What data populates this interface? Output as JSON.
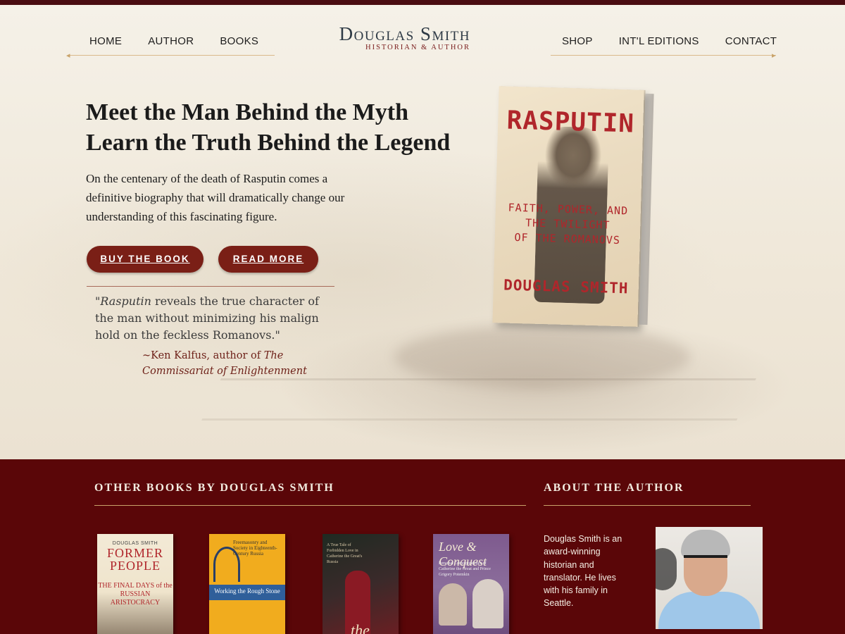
{
  "nav": {
    "left": [
      "HOME",
      "AUTHOR",
      "BOOKS"
    ],
    "right": [
      "SHOP",
      "INT'L EDITIONS",
      "CONTACT"
    ]
  },
  "logo": {
    "name": "Douglas Smith",
    "tagline": "HISTORIAN & AUTHOR"
  },
  "hero": {
    "headline_line1": "Meet the Man Behind the Myth",
    "headline_line2": "Learn the Truth Behind the Legend",
    "intro": "On the centenary of the death of Rasputin comes a definitive biography that will dramatically change our understanding of this fascinating figure.",
    "buy_label": "BUY THE BOOK",
    "read_label": "READ MORE",
    "quote_open": "\"",
    "quote_title": "Rasputin",
    "quote_rest": " reveals the true character of the man without minimizing his malign hold on the feckless Romanovs.\"",
    "attribution_prefix": "~Ken Kalfus, author of ",
    "attribution_work": "The Commissariat of Enlightenment"
  },
  "cover": {
    "title": "RASPUTIN",
    "subtitle_line1": "FAITH, POWER, AND",
    "subtitle_line2": "THE TWILIGHT",
    "subtitle_line3": "OF THE ROMANOVS",
    "author": "DOUGLAS SMITH"
  },
  "other_books": {
    "heading": "OTHER BOOKS BY DOUGLAS SMITH",
    "books": [
      {
        "author": "DOUGLAS SMITH",
        "title_line1": "FORMER",
        "title_line2": "PEOPLE",
        "subtitle": "THE FINAL DAYS of the RUSSIAN ARISTOCRACY"
      },
      {
        "top_text": "Freemasonry and Society in Eighteenth-Century Russia",
        "title": "Working the Rough Stone"
      },
      {
        "top_text": "A True Tale of Forbidden Love in Catherine the Great's Russia",
        "title": "the Pearl"
      },
      {
        "title": "Love & Conquest",
        "subtitle": "Personal Correspondence of Catherine the Great and Prince Grigory Potemkin"
      }
    ]
  },
  "about": {
    "heading": "ABOUT THE AUTHOR",
    "text": "Douglas Smith is an award-winning historian and translator. He lives with his family in Seattle."
  },
  "colors": {
    "accent": "#7a1f16",
    "footer_bg": "#5a0608",
    "cover_red": "#b0262b"
  }
}
